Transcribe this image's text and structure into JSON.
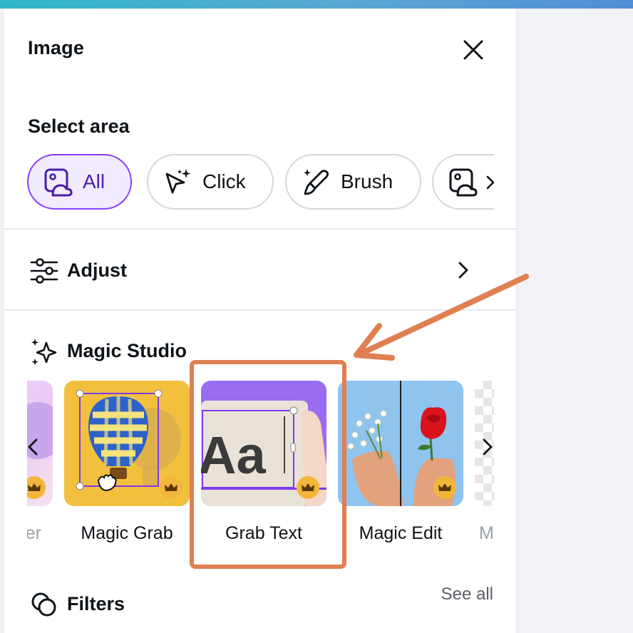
{
  "panel": {
    "title": "Image"
  },
  "select_area": {
    "label": "Select area",
    "chips": [
      {
        "label": "All",
        "icon": "image-icon",
        "active": true
      },
      {
        "label": "Click",
        "icon": "magic-click-icon",
        "active": false
      },
      {
        "label": "Brush",
        "icon": "magic-brush-icon",
        "active": false
      },
      {
        "label": "",
        "icon": "image-icon",
        "active": false
      }
    ]
  },
  "adjust": {
    "label": "Adjust"
  },
  "magic_studio": {
    "label": "Magic Studio",
    "cards": [
      {
        "label": "er",
        "partial": true
      },
      {
        "label": "Magic Grab",
        "premium": true
      },
      {
        "label": "Grab Text",
        "premium": true
      },
      {
        "label": "Magic Edit",
        "premium": true
      },
      {
        "label": "M",
        "partial": true
      }
    ]
  },
  "filters": {
    "label": "Filters",
    "see_all": "See all"
  },
  "colors": {
    "accent": "#8b3dff",
    "annotation": "#df7f52",
    "crown": "#f4b63a"
  }
}
